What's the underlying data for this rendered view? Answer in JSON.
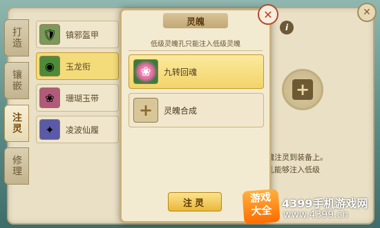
{
  "side_tabs": [
    {
      "label": "打造"
    },
    {
      "label": "镶嵌"
    },
    {
      "label": "注灵"
    },
    {
      "label": "修理"
    }
  ],
  "items": [
    {
      "name": "镇邪盔甲",
      "color": "#7a9a5a"
    },
    {
      "name": "玉龙衔",
      "color": "#4f8a3a"
    },
    {
      "name": "珊瑚玉带",
      "color": "#b25a7a"
    },
    {
      "name": "凌波仙履",
      "color": "#5a5aa8"
    }
  ],
  "right": {
    "info_label": "i",
    "desc_line1": "灵魂注灵到装备上。",
    "desc_line2": "级孔能够注入低级"
  },
  "popup": {
    "title": "灵魄",
    "hint": "低级灵魄孔只能注入低级灵魄",
    "options": [
      {
        "label": "九转回魂"
      },
      {
        "label": "灵魄合成"
      }
    ],
    "inject_label": "注灵"
  },
  "watermark": {
    "badge_line1": "游戏",
    "badge_line2": "大全",
    "line1": "4399手机游戏网",
    "line2": "www.4399.cn"
  }
}
